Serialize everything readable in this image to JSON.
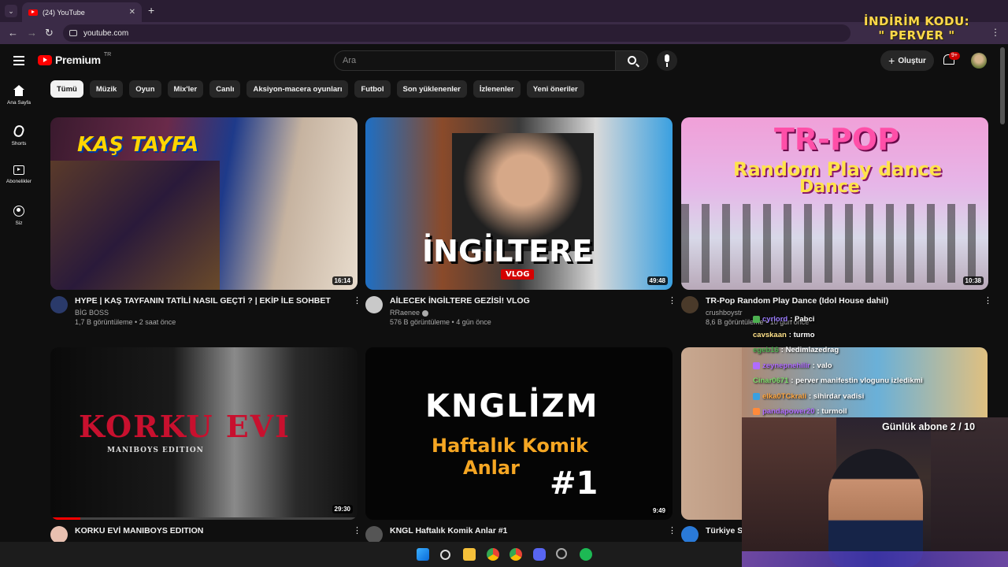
{
  "browser": {
    "tab_title": "(24) YouTube",
    "tab_close": "✕",
    "new_tab": "+",
    "url": "youtube.com",
    "menu_glyph": "⌄",
    "more_glyph": "⋮",
    "back_glyph": "←",
    "forward_glyph": "→",
    "reload_glyph": "↻"
  },
  "promo": {
    "line1": "İNDİRİM KODU:",
    "line2": "\" PERVER \""
  },
  "header": {
    "logo_text": "Premium",
    "region": "TR",
    "search_placeholder": "Ara",
    "create_label": "Oluştur",
    "create_glyph": "+",
    "notifications_badge": "9+"
  },
  "sidebar": {
    "items": [
      {
        "label": "Ana Sayfa",
        "icon": "home-icon"
      },
      {
        "label": "Shorts",
        "icon": "shorts-icon"
      },
      {
        "label": "Abonelikler",
        "icon": "subscriptions-icon"
      },
      {
        "label": "Siz",
        "icon": "you-icon"
      }
    ]
  },
  "chips": [
    "Tümü",
    "Müzik",
    "Oyun",
    "Mix'ler",
    "Canlı",
    "Aksiyon-macera oyunları",
    "Futbol",
    "Son yüklenenler",
    "İzlenenler",
    "Yeni öneriler"
  ],
  "videos": [
    {
      "title": "HYPE | KAŞ TAYFANIN TATİLİ NASIL GEÇTİ ? | EKİP İLE SOHBET",
      "channel": "BİG BOSS",
      "stats": "1,7 B görüntüleme • 2 saat önce",
      "duration": "16:14",
      "thumb_text": "KAŞ TAYFA",
      "kebab": "⋮"
    },
    {
      "title": "AİLECEK İNGİLTERE GEZİSİ! VLOG",
      "channel": "RRaenee",
      "stats": "576 B görüntüleme • 4 gün önce",
      "duration": "49:48",
      "thumb_text": "İNGİLTERE",
      "thumb_badge": "VLOG",
      "kebab": "⋮"
    },
    {
      "title": "TR-Pop Random Play Dance (Idol House dahil)",
      "channel": "crushboystr",
      "stats": "8,6 B görüntüleme • 10 gün önce",
      "duration": "10:38",
      "thumb_text_1": "TR-POP",
      "thumb_text_2": "Random Play dance",
      "thumb_text_3": "Dance",
      "kebab": "⋮"
    },
    {
      "title": "KORKU EVİ MANIBOYS EDITION",
      "duration": "29:30",
      "thumb_text_1": "KORKU EVI",
      "thumb_text_2": "MANIBOYS EDITION",
      "kebab": "⋮"
    },
    {
      "title": "KNGL Haftalık Komik Anlar #1",
      "duration": "9:49",
      "thumb_text_1": "KNGLİZM",
      "thumb_text_2": "Haftalık Komik",
      "thumb_text_3": "Anlar",
      "thumb_text_4": "#1",
      "kebab": "⋮"
    },
    {
      "title": "Türkiye S",
      "kebab": "⋮"
    }
  ],
  "chat": [
    {
      "user": "cyrlord",
      "message": "Pabci",
      "color": "#9b7cff"
    },
    {
      "user": "cavskaan",
      "message": "turmo",
      "color": "#ffe28a"
    },
    {
      "user": "egeb16",
      "message": "Nedimlazedrag",
      "color": "#4caf50"
    },
    {
      "user": "zeynepnehilir",
      "message": "valo",
      "color": "#b06cff"
    },
    {
      "user": "Cinar0671",
      "message": "perver manifestin vlogunu izledikmi",
      "color": "#7ddc6b"
    },
    {
      "user": "elka0TCkrali",
      "message": "sihirdar vadisi",
      "color": "#ffa640"
    },
    {
      "user": "pandapower20",
      "message": "turmoil",
      "color": "#b06cff"
    }
  ],
  "stream": {
    "sub_goal": "Günlük abone 2 / 10"
  },
  "colors": {
    "background": "#0f0f0f",
    "accent_red": "#ff0000",
    "chrome": "#2a1d33"
  }
}
